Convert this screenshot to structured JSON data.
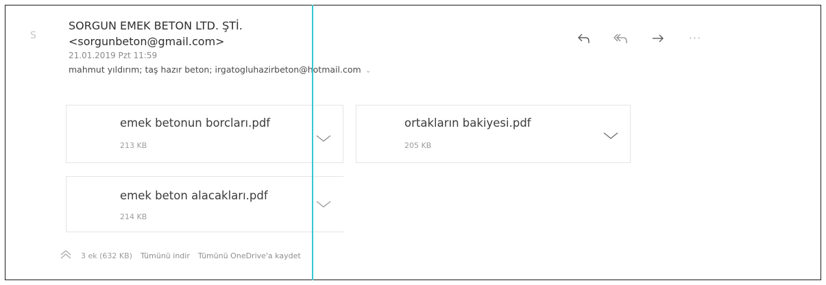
{
  "email": {
    "avatar_letter": "S",
    "sender": "SORGUN EMEK BETON LTD. ŞTİ. <sorgunbeton@gmail.com>",
    "date": "21.01.2019 Pzt 11:59",
    "recipients": "mahmut yıldırım; taş hazır beton; irgatogluhazirbeton@hotmail.com"
  },
  "actions": {
    "reply_icon": "reply-icon",
    "reply_all_icon": "reply-all-icon",
    "forward_icon": "forward-icon",
    "more_label": "···"
  },
  "attachments": [
    {
      "name": "emek betonun borcları.pdf",
      "size": "213 KB"
    },
    {
      "name": "ortakların bakiyesi.pdf",
      "size": "205 KB"
    },
    {
      "name": "emek beton alacakları.pdf",
      "size": "214 KB"
    }
  ],
  "footer": {
    "summary": "3 ek (632 KB)",
    "download_all": "Tümünü indir",
    "save_onedrive": "Tümünü OneDrive'a kaydet"
  },
  "colors": {
    "cursor_line": "#35c6cf",
    "frame_border": "#1a1a1a"
  }
}
